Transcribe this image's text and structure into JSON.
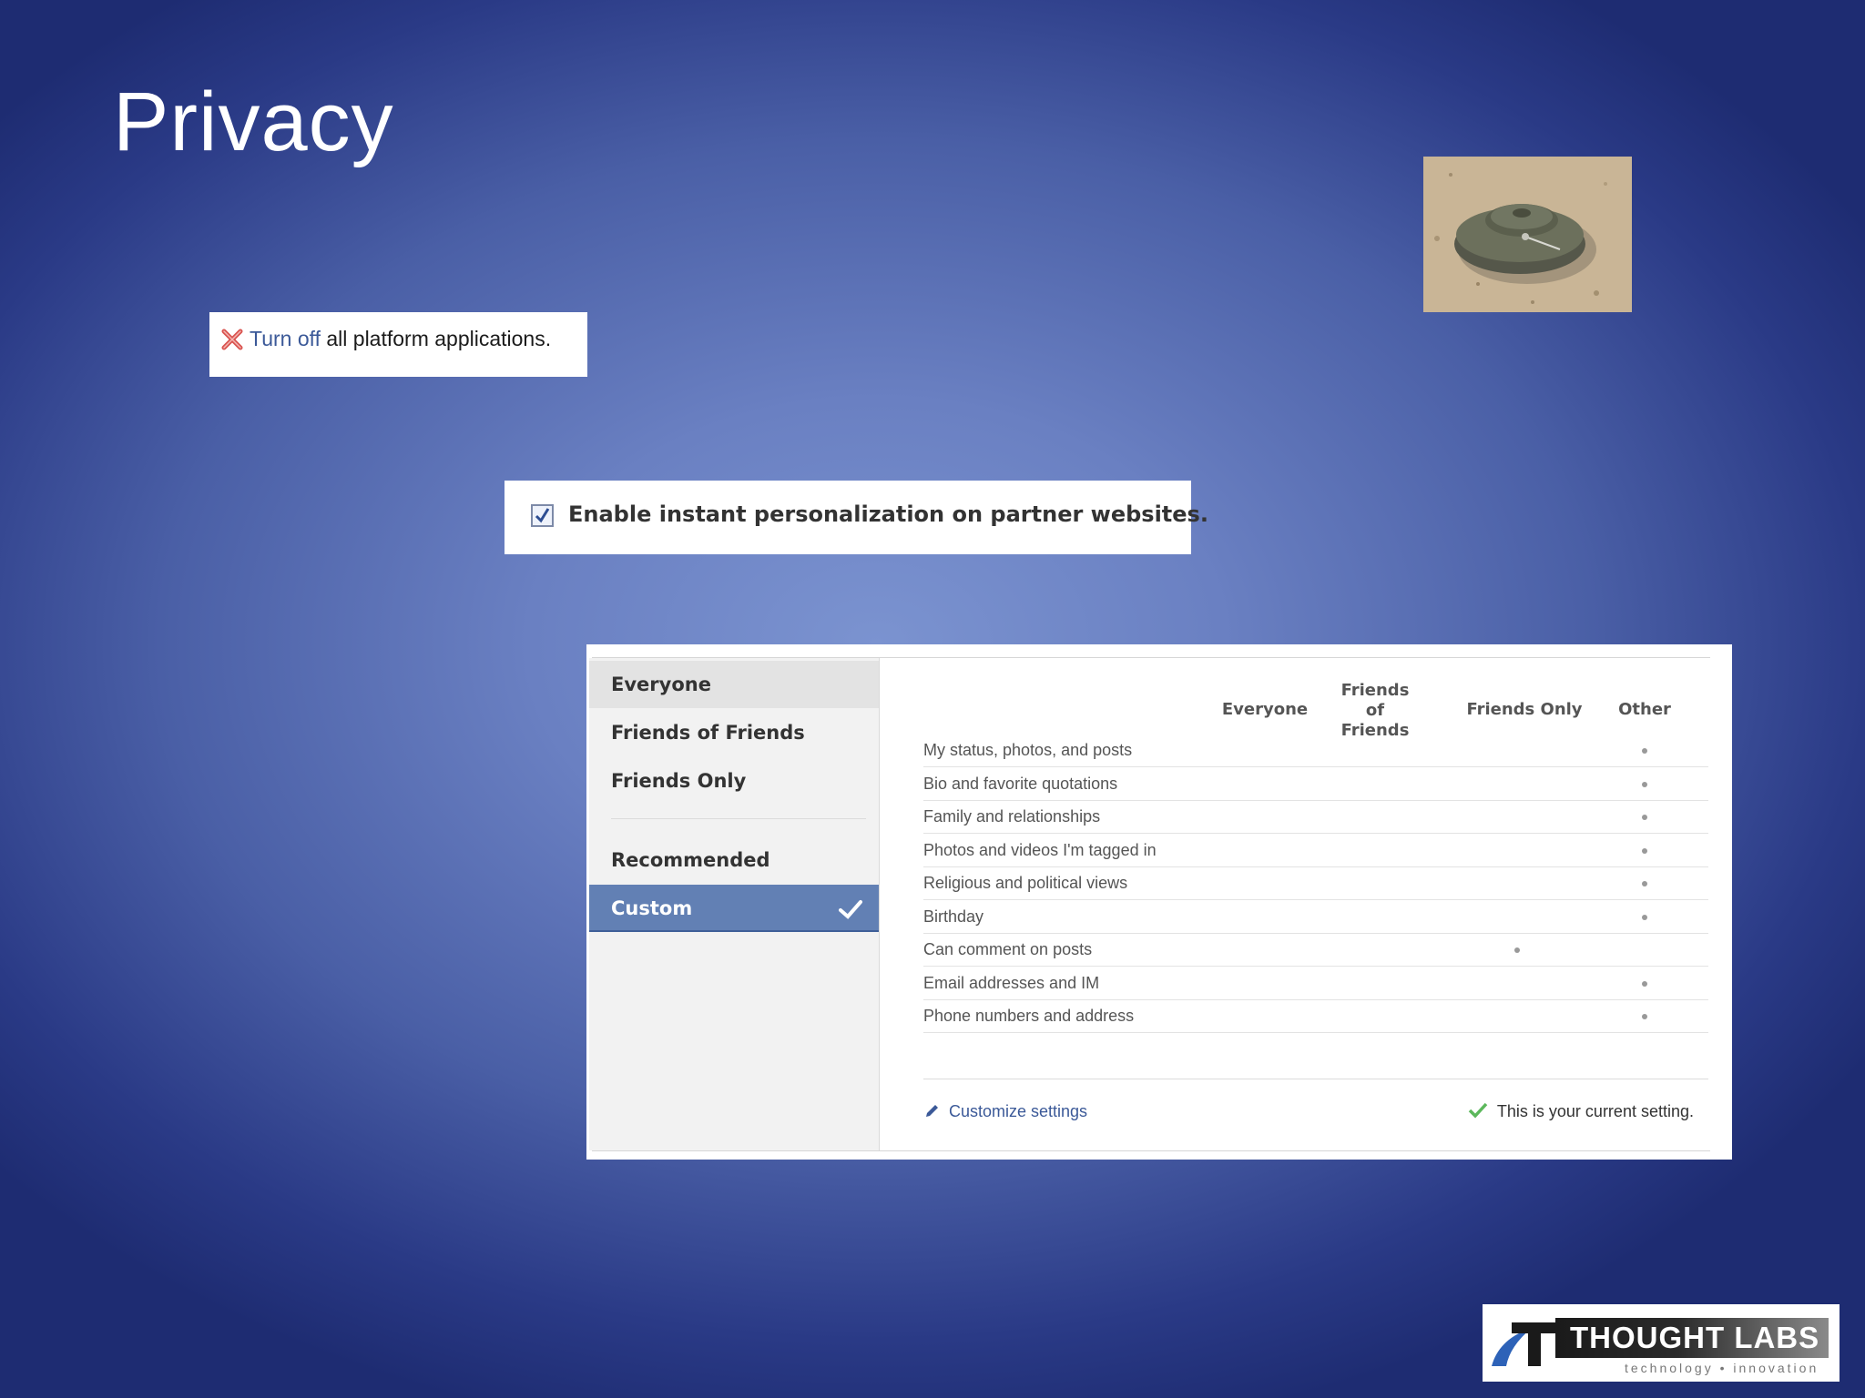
{
  "slide": {
    "title": "Privacy"
  },
  "platform": {
    "link_text": "Turn off",
    "rest_text": " all platform applications."
  },
  "instant": {
    "label": "Enable instant personalization on partner websites.",
    "checked": true
  },
  "panel": {
    "sidebar": [
      {
        "label": "Everyone"
      },
      {
        "label": "Friends of Friends"
      },
      {
        "label": "Friends Only"
      },
      {
        "label": "Recommended"
      },
      {
        "label": "Custom",
        "selected": true
      }
    ],
    "columns": [
      "Everyone",
      "Friends of Friends",
      "Friends Only",
      "Other"
    ],
    "rows": [
      {
        "label": "My status, photos, and posts",
        "setting": "Other"
      },
      {
        "label": "Bio and favorite quotations",
        "setting": "Other"
      },
      {
        "label": "Family and relationships",
        "setting": "Other"
      },
      {
        "label": "Photos and videos I'm tagged in",
        "setting": "Other"
      },
      {
        "label": "Religious and political views",
        "setting": "Other"
      },
      {
        "label": "Birthday",
        "setting": "Other"
      },
      {
        "label": "Can comment on posts",
        "setting": "Friends Only"
      },
      {
        "label": "Email addresses and IM",
        "setting": "Other"
      },
      {
        "label": "Phone numbers and address",
        "setting": "Other"
      }
    ],
    "customize_link": "Customize settings",
    "current_setting": "This is your current setting."
  },
  "logo": {
    "name": "THOUGHT LABS",
    "tagline": "technology • innovation"
  },
  "icons": {
    "remove": "x-icon",
    "edit": "pencil-icon",
    "confirm": "check-icon",
    "selected": "checkmark-icon"
  },
  "colors": {
    "link": "#3b5998",
    "selected_bg": "#6280b4"
  }
}
